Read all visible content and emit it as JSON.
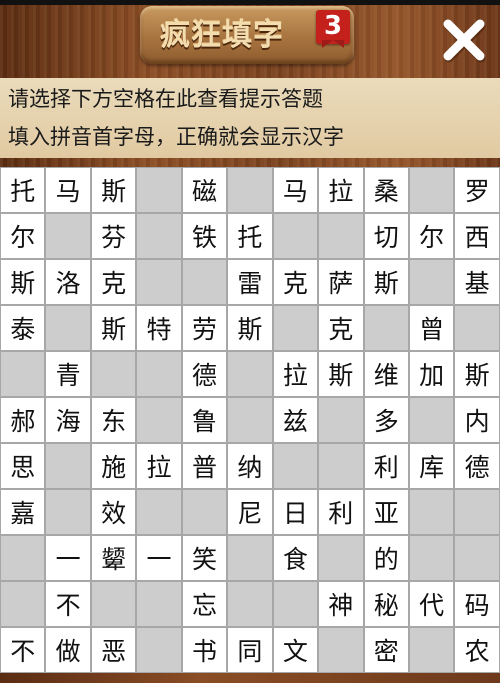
{
  "header": {
    "title": "疯狂填字",
    "level": "3",
    "close_icon": "close-x-icon"
  },
  "hint": {
    "line1": "请选择下方空格在此查看提示答题",
    "line2": "填入拼音首字母，正确就会显示汉字"
  },
  "colors": {
    "filled_cell": "#ffffff",
    "empty_cell": "#cdcdcd",
    "hint_panel": "#e6d2ae",
    "badge": "#c4211d"
  },
  "grid": {
    "rows": [
      [
        "托",
        "马",
        "斯",
        "",
        "磁",
        "",
        "马",
        "拉",
        "桑",
        "",
        "罗"
      ],
      [
        "尔",
        "",
        "芬",
        "",
        "铁",
        "托",
        "",
        "",
        "切",
        "尔",
        "西"
      ],
      [
        "斯",
        "洛",
        "克",
        "",
        "",
        "雷",
        "克",
        "萨",
        "斯",
        "",
        "基"
      ],
      [
        "泰",
        "",
        "斯",
        "特",
        "劳",
        "斯",
        "",
        "克",
        "",
        "曾",
        ""
      ],
      [
        "",
        "青",
        "",
        "",
        "德",
        "",
        "拉",
        "斯",
        "维",
        "加",
        "斯"
      ],
      [
        "郝",
        "海",
        "东",
        "",
        "鲁",
        "",
        "兹",
        "",
        "多",
        "",
        "内"
      ],
      [
        "思",
        "",
        "施",
        "拉",
        "普",
        "纳",
        "",
        "",
        "利",
        "库",
        "德"
      ],
      [
        "嘉",
        "",
        "效",
        "",
        "",
        "尼",
        "日",
        "利",
        "亚",
        "",
        ""
      ],
      [
        "",
        "一",
        "颦",
        "一",
        "笑",
        "",
        "食",
        "",
        "的",
        "",
        ""
      ],
      [
        "",
        "不",
        "",
        "",
        "忘",
        "",
        "",
        "神",
        "秘",
        "代",
        "码"
      ],
      [
        "不",
        "做",
        "恶",
        "",
        "书",
        "同",
        "文",
        "",
        "密",
        "",
        "农"
      ]
    ],
    "filled": [
      [
        1,
        1,
        1,
        0,
        1,
        0,
        1,
        1,
        1,
        0,
        1
      ],
      [
        1,
        0,
        1,
        0,
        1,
        1,
        0,
        0,
        1,
        1,
        1
      ],
      [
        1,
        1,
        1,
        0,
        0,
        1,
        1,
        1,
        1,
        0,
        1
      ],
      [
        1,
        0,
        1,
        1,
        1,
        1,
        0,
        1,
        0,
        1,
        0
      ],
      [
        0,
        1,
        0,
        0,
        1,
        0,
        1,
        1,
        1,
        1,
        1
      ],
      [
        1,
        1,
        1,
        0,
        1,
        0,
        1,
        0,
        1,
        0,
        1
      ],
      [
        1,
        0,
        1,
        1,
        1,
        1,
        0,
        0,
        1,
        1,
        1
      ],
      [
        1,
        0,
        1,
        0,
        0,
        1,
        1,
        1,
        1,
        0,
        0
      ],
      [
        0,
        1,
        1,
        1,
        1,
        0,
        1,
        0,
        1,
        0,
        0
      ],
      [
        0,
        1,
        0,
        0,
        1,
        0,
        0,
        1,
        1,
        1,
        1
      ],
      [
        1,
        1,
        1,
        0,
        1,
        1,
        1,
        0,
        1,
        0,
        1
      ]
    ]
  }
}
